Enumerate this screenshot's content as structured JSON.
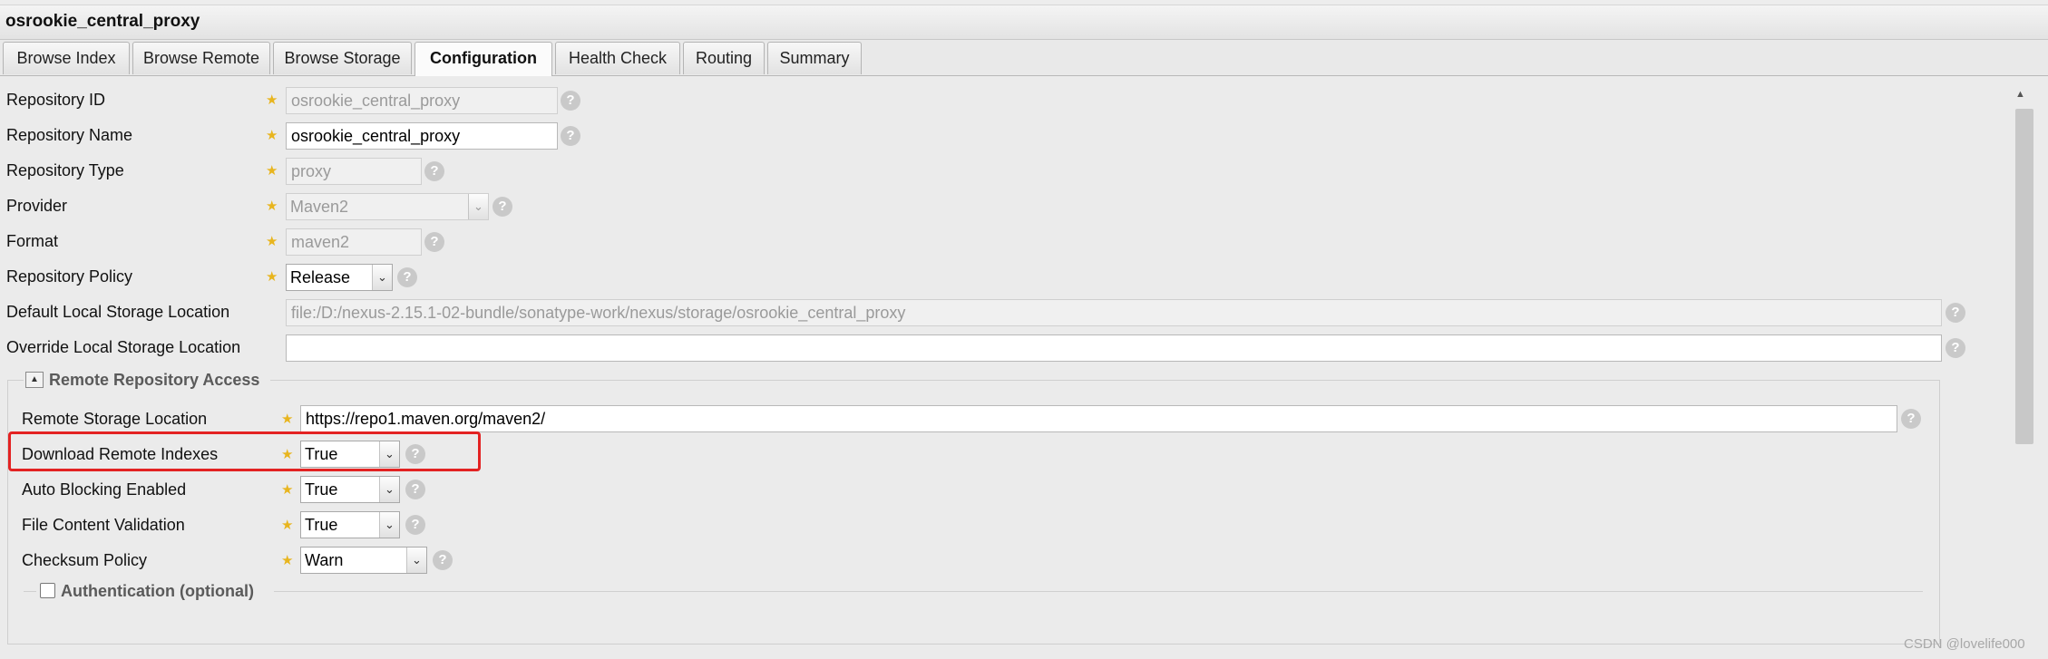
{
  "window": {
    "title": "osrookie_central_proxy"
  },
  "tabs": [
    {
      "label": "Browse Index"
    },
    {
      "label": "Browse Remote"
    },
    {
      "label": "Browse Storage"
    },
    {
      "label": "Configuration"
    },
    {
      "label": "Health Check"
    },
    {
      "label": "Routing"
    },
    {
      "label": "Summary"
    }
  ],
  "active_tab": "Configuration",
  "form": {
    "repository_id": {
      "label": "Repository ID",
      "value": "osrookie_central_proxy"
    },
    "repository_name": {
      "label": "Repository Name",
      "value": "osrookie_central_proxy"
    },
    "repository_type": {
      "label": "Repository Type",
      "value": "proxy"
    },
    "provider": {
      "label": "Provider",
      "value": "Maven2"
    },
    "format": {
      "label": "Format",
      "value": "maven2"
    },
    "repository_policy": {
      "label": "Repository Policy",
      "value": "Release"
    },
    "default_local_storage": {
      "label": "Default Local Storage Location",
      "value": "file:/D:/nexus-2.15.1-02-bundle/sonatype-work/nexus/storage/osrookie_central_proxy"
    },
    "override_local_storage": {
      "label": "Override Local Storage Location",
      "value": ""
    }
  },
  "remote_access": {
    "legend": "Remote Repository Access",
    "remote_storage_location": {
      "label": "Remote Storage Location",
      "value": "https://repo1.maven.org/maven2/"
    },
    "download_remote_indexes": {
      "label": "Download Remote Indexes",
      "value": "True"
    },
    "auto_blocking_enabled": {
      "label": "Auto Blocking Enabled",
      "value": "True"
    },
    "file_content_validation": {
      "label": "File Content Validation",
      "value": "True"
    },
    "checksum_policy": {
      "label": "Checksum Policy",
      "value": "Warn"
    }
  },
  "authentication": {
    "legend": "Authentication (optional)",
    "checked": false
  },
  "help_glyph": "?",
  "required_glyph": "★",
  "dropdown_glyph": "⌄",
  "collapse_glyph": "▲",
  "watermark": "CSDN @lovelife000",
  "colors": {
    "highlight": "#e32222",
    "required_star": "#e8b51e",
    "help_icon": "#c9c9c9"
  }
}
